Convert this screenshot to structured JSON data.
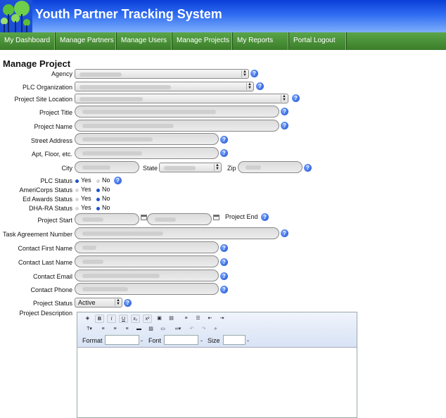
{
  "header": {
    "title": "Youth Partner Tracking System",
    "logo_icon": "tree-logo-icon"
  },
  "nav": {
    "items": [
      "My Dashboard",
      "Manage Partners",
      "Manage Users",
      "Manage Projects",
      "My Reports",
      "Portal Logout"
    ]
  },
  "page": {
    "heading": "Manage Project"
  },
  "form": {
    "agency_label": "Agency",
    "plc_org_label": "PLC Organization",
    "site_location_label": "Project Site Location",
    "title_label": "Project Title",
    "name_label": "Project Name",
    "street_label": "Street Address",
    "apt_label": "Apt, Floor, etc.",
    "city_label": "City",
    "state_label": "State",
    "zip_label": "Zip",
    "plc_status_label": "PLC Status",
    "americorps_label": "AmeriCorps Status",
    "ed_awards_label": "Ed Awards Status",
    "dha_ra_label": "DHA-RA Status",
    "yes_label": "Yes",
    "no_label": "No",
    "start_label": "Project Start",
    "end_label": "Project End",
    "task_label": "Task Agreement Number",
    "contact_first_label": "Contact First Name",
    "contact_last_label": "Contact Last Name",
    "contact_email_label": "Contact Email",
    "contact_phone_label": "Contact Phone",
    "status_label": "Project Status",
    "status_value": "Active",
    "description_label": "Project Description",
    "help_glyph": "?"
  },
  "radios": {
    "plc_status": "Yes",
    "americorps_status": "No",
    "ed_awards_status": "No",
    "dha_ra_status": "No"
  },
  "editor": {
    "format_label": "Format",
    "font_label": "Font",
    "size_label": "Size"
  },
  "colors": {
    "header_blue": "#2f6cf2",
    "nav_green": "#4a9238",
    "help_blue": "#1a4fd0"
  }
}
